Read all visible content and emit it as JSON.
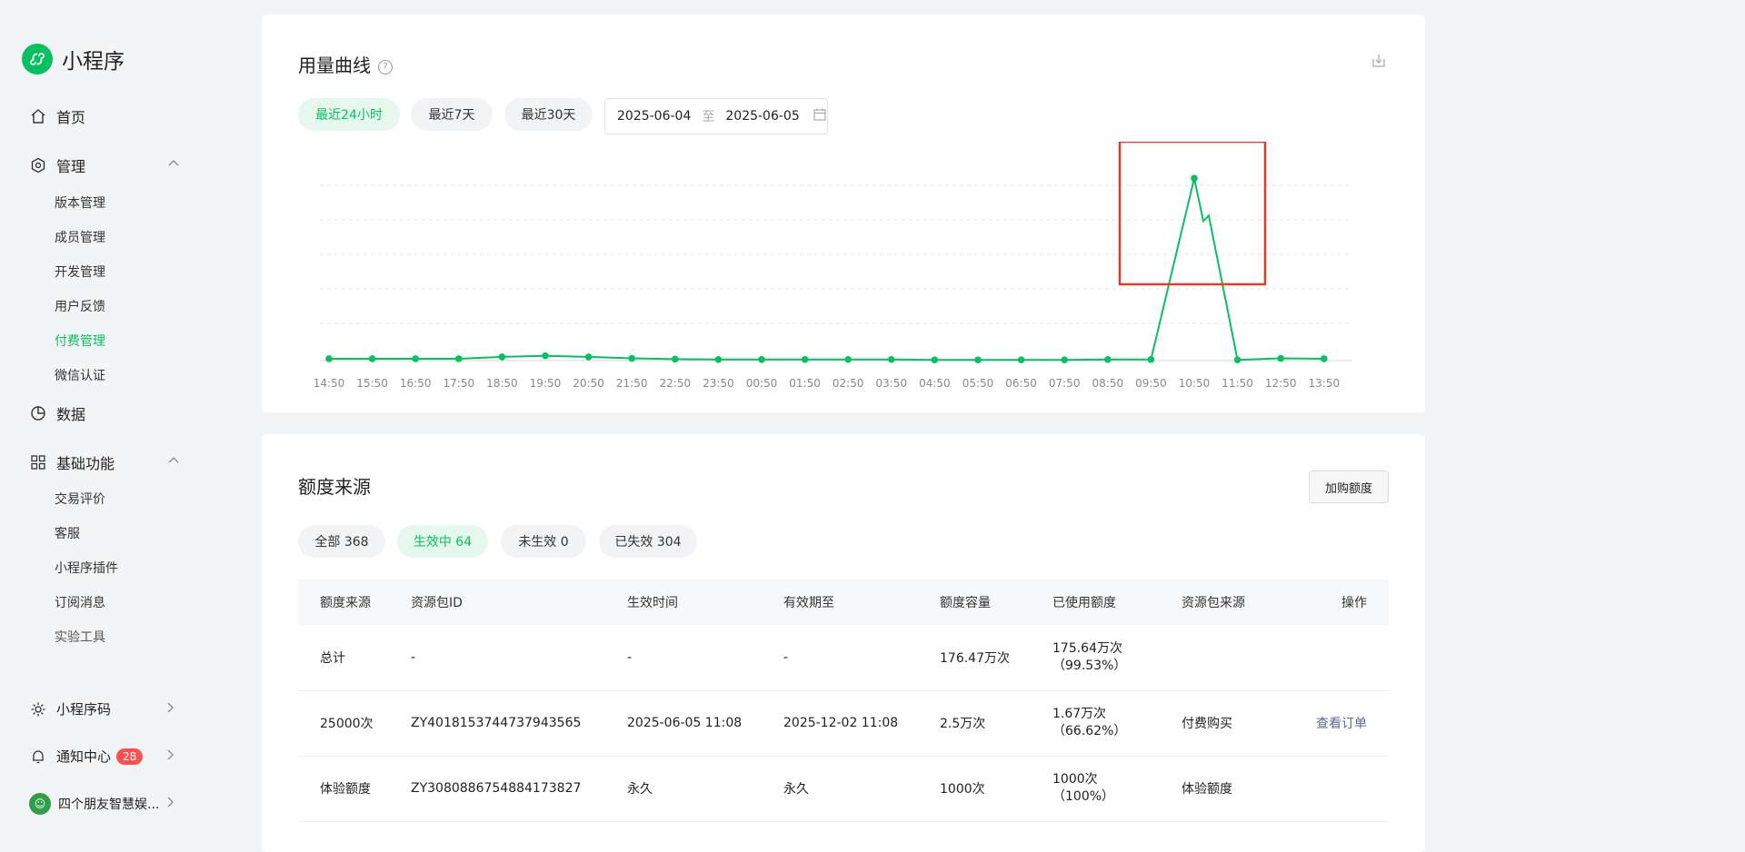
{
  "sidebar": {
    "brand": "小程序",
    "home": "首页",
    "manage": {
      "label": "管理",
      "items": [
        "版本管理",
        "成员管理",
        "开发管理",
        "用户反馈",
        "付费管理",
        "微信认证"
      ],
      "active_index": 4
    },
    "data": "数据",
    "basic": {
      "label": "基础功能",
      "items": [
        "交易评价",
        "客服",
        "小程序插件",
        "订阅消息",
        "实验工具"
      ]
    },
    "bottom": {
      "qrcode": "小程序码",
      "notify": "通知中心",
      "notify_count": "28",
      "account": "四个朋友智慧娱..."
    }
  },
  "usage": {
    "title": "用量曲线",
    "help_icon": "question-icon",
    "export_icon": "export-icon",
    "ranges": [
      "最近24小时",
      "最近7天",
      "最近30天"
    ],
    "active_range": 0,
    "date_from": "2025-06-04",
    "date_sep": "至",
    "date_to": "2025-06-05"
  },
  "chart_data": {
    "type": "line",
    "x": [
      "14:50",
      "15:50",
      "16:50",
      "17:50",
      "18:50",
      "19:50",
      "20:50",
      "21:50",
      "22:50",
      "23:50",
      "00:50",
      "01:50",
      "02:50",
      "03:50",
      "04:50",
      "05:50",
      "06:50",
      "07:50",
      "08:50",
      "09:50",
      "10:50",
      "11:50",
      "12:50",
      "13:50"
    ],
    "values": [
      0.5,
      0.5,
      0.5,
      0.5,
      1.0,
      1.3,
      1.0,
      0.6,
      0.4,
      0.3,
      0.3,
      0.3,
      0.3,
      0.3,
      0.2,
      0.2,
      0.2,
      0.2,
      0.3,
      0.3,
      49,
      0.2,
      0.6,
      0.5
    ],
    "peak_detail": [
      {
        "x": "11:10",
        "value": 37.5
      }
    ],
    "grid": true,
    "annotation": "red highlight box around 10:50 peak",
    "colors": {
      "line": "#07c160",
      "highlight": "#e23b2a"
    }
  },
  "quota": {
    "title": "额度来源",
    "buy_button": "加购额度",
    "filters": [
      "全部 368",
      "生效中 64",
      "未生效 0",
      "已失效 304"
    ],
    "active_filter": 1,
    "columns": [
      "额度来源",
      "资源包ID",
      "生效时间",
      "有效期至",
      "额度容量",
      "已使用额度",
      "资源包来源",
      "操作"
    ],
    "rows": [
      {
        "source": "总计",
        "pkg_id": "-",
        "start": "-",
        "end": "-",
        "capacity": "176.47万次",
        "used": "175.64万次",
        "used_pct": "（99.53%）",
        "origin": "",
        "action": ""
      },
      {
        "source": "25000次",
        "pkg_id": "ZY4018153744737943565",
        "start": "2025-06-05 11:08",
        "end": "2025-12-02 11:08",
        "capacity": "2.5万次",
        "used": "1.67万次",
        "used_pct": "（66.62%）",
        "origin": "付费购买",
        "action": "查看订单"
      },
      {
        "source": "体验额度",
        "pkg_id": "ZY3080886754884173827",
        "start": "永久",
        "end": "永久",
        "capacity": "1000次",
        "used": "1000次",
        "used_pct": "（100%）",
        "origin": "体验额度",
        "action": ""
      }
    ]
  }
}
